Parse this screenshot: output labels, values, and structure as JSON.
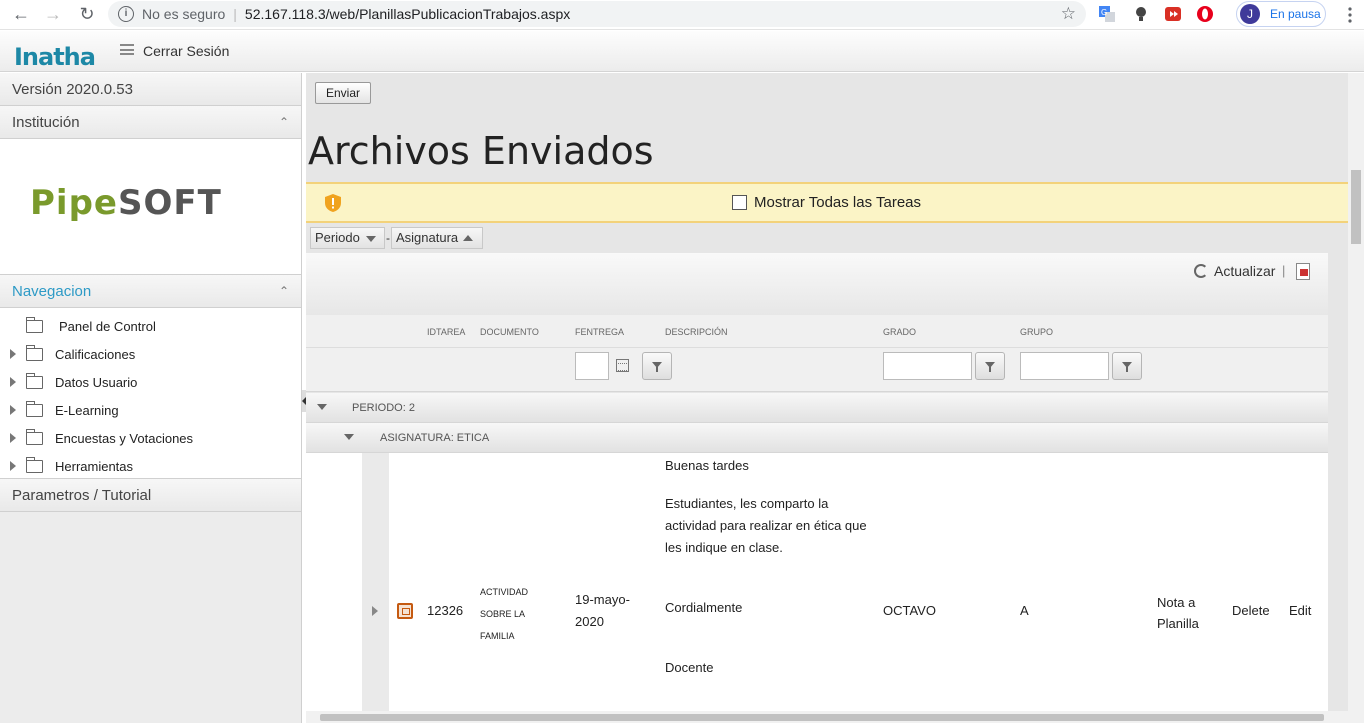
{
  "browser": {
    "security_label": "No es seguro",
    "url": "52.167.118.3/web/PlanillasPublicacionTrabajos.aspx",
    "profile_initial": "J",
    "profile_status": "En pausa"
  },
  "header": {
    "logo_text": "Inatha",
    "logout_label": "Cerrar Sesión"
  },
  "sidebar": {
    "version": "Versión 2020.0.53",
    "institution_label": "Institución",
    "institution_logo_text_1": "Pipe",
    "institution_logo_text_2": "SOFT",
    "nav_title": "Navegacion",
    "items": [
      {
        "label": "Panel de Control",
        "expandable": false
      },
      {
        "label": "Calificaciones",
        "expandable": true
      },
      {
        "label": "Datos Usuario",
        "expandable": true
      },
      {
        "label": "E-Learning",
        "expandable": true
      },
      {
        "label": "Encuestas y Votaciones",
        "expandable": true
      },
      {
        "label": "Herramientas",
        "expandable": true
      }
    ],
    "params_label": "Parametros / Tutorial"
  },
  "main": {
    "send_label": "Enviar",
    "title": "Archivos Enviados",
    "show_all_label": "Mostrar Todas las Tareas",
    "group_chips": [
      "Periodo",
      "Asignatura"
    ],
    "refresh_label": "Actualizar",
    "columns": [
      "IDTAREA",
      "DOCUMENTO",
      "FENTREGA",
      "DESCRIPCIÓN",
      "GRADO",
      "GRUPO"
    ],
    "group_period": "PERIODO: 2",
    "group_subject": "ASIGNATURA: ETICA",
    "row": {
      "id": "12326",
      "document_1": "ACTIVIDAD",
      "document_2": "SOBRE LA",
      "document_3": "FAMILIA",
      "date_1": "19-mayo-",
      "date_2": "2020",
      "desc_1": "Buenas tardes",
      "desc_2": "Estudiantes, les comparto la actividad para realizar en ética que les indique en clase.",
      "desc_3": "Cordialmente",
      "desc_4": "Docente",
      "grade": "OCTAVO",
      "group": "A",
      "action_grade_1": "Nota a",
      "action_grade_2": "Planilla",
      "action_delete": "Delete",
      "action_edit": "Edit"
    }
  },
  "colors": {
    "accent": "#2d9ac6",
    "warning_bg": "#fbf4c6",
    "warning_border": "#f3d27a"
  }
}
